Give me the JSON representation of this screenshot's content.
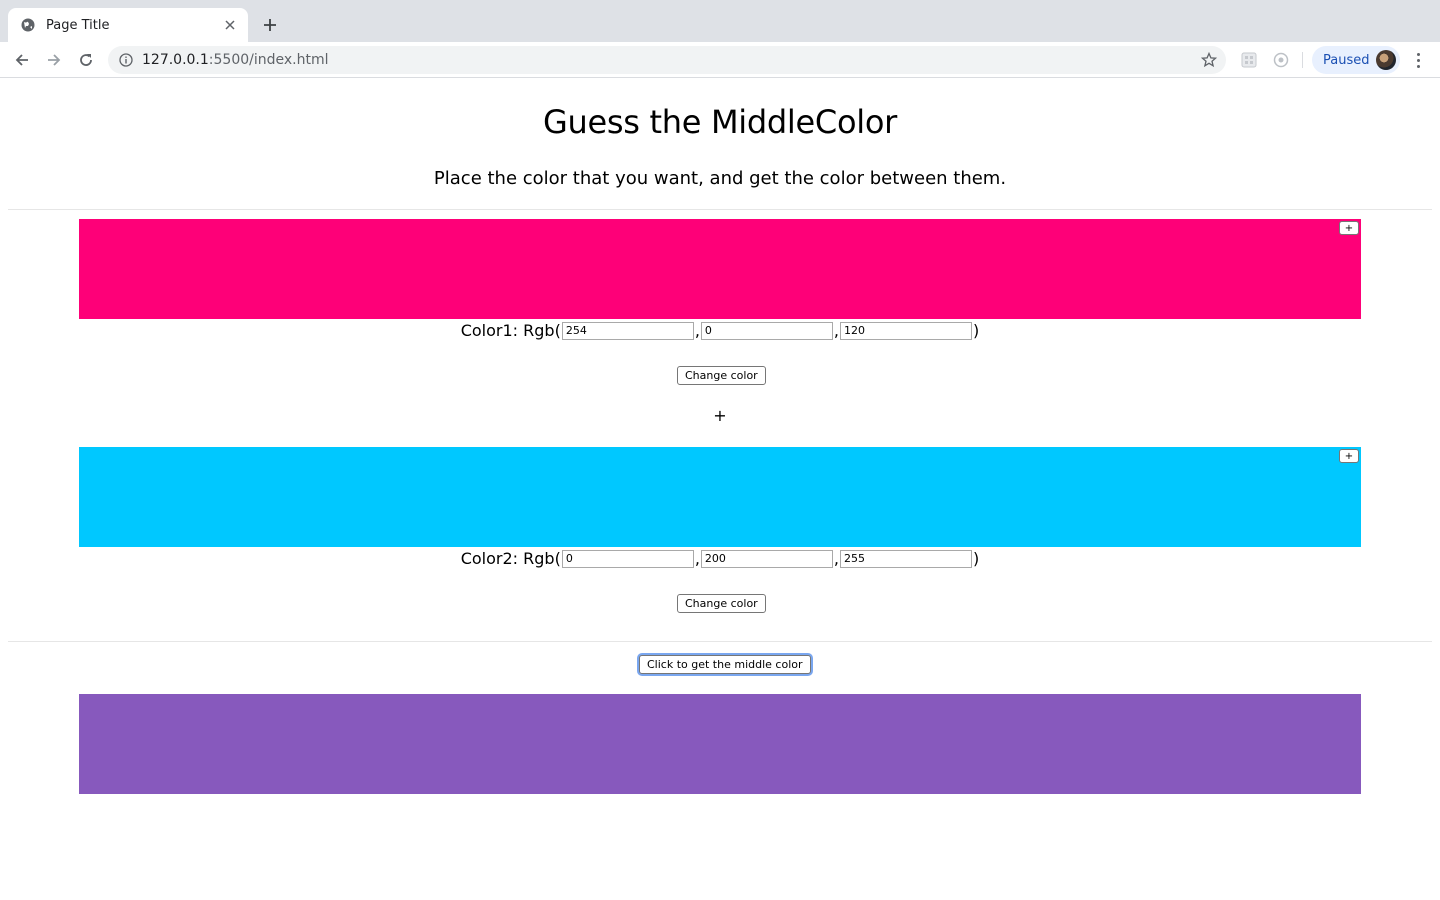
{
  "browser": {
    "tab_title": "Page Title",
    "url_host": "127.0.0.1",
    "url_rest": ":5500/index.html",
    "profile_label": "Paused"
  },
  "page": {
    "title": "Guess the MiddleColor",
    "subtitle": "Place the color that you want, and get the color between them.",
    "plus_sign": "+",
    "color1": {
      "label": "Color1: Rgb(",
      "r": "254",
      "g": "0",
      "b": "120",
      "swatch_color": "#fe0078",
      "plus_button": "+",
      "change_button": "Change color"
    },
    "color2": {
      "label": "Color2: Rgb(",
      "r": "0",
      "g": "200",
      "b": "255",
      "swatch_color": "#00c8ff",
      "plus_button": "+",
      "change_button": "Change color"
    },
    "middle_button": "Click to get the middle color",
    "middle_color": "#8759bd"
  },
  "punctuation": {
    "comma": ",",
    "close_paren": ")"
  }
}
